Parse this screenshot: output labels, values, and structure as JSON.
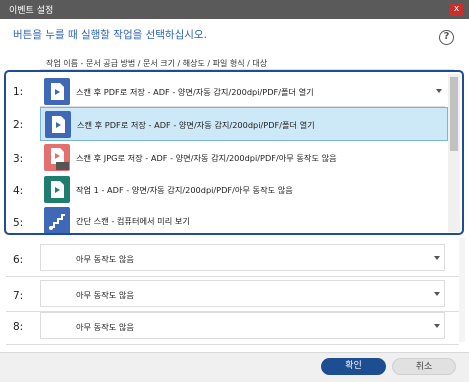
{
  "window": {
    "title": "이벤트 설정",
    "close_label": "x"
  },
  "instruction": "버튼을 누를 때 실행할 작업을 선택하십시오.",
  "help_label": "?",
  "column_header": "작업 이름 - 문서 공급 방법 / 문서 크기 / 해상도 / 파일 형식 / 대상",
  "rows": [
    {
      "num": "1:",
      "value": "스캔 후 PDF로 저장 - ADF - 양면/자동 감지/200dpi/PDF/폴더 열기"
    },
    {
      "num": "2:"
    },
    {
      "num": "3:"
    },
    {
      "num": "4:"
    },
    {
      "num": "5:"
    },
    {
      "num": "6:",
      "value": "아무 동작도 않음"
    },
    {
      "num": "7:",
      "value": "아무 동작도 않음"
    },
    {
      "num": "8:",
      "value": "아무 동작도 않음"
    }
  ],
  "dropdown_options": [
    {
      "label": "스캔 후 PDF로 저장 - ADF - 양면/자동 감지/200dpi/PDF/폴더 열기",
      "icon": "pdf-scan-icon",
      "color": "#3f69b6"
    },
    {
      "label": "스캔 후 JPG로 저장 - ADF - 양면/자동 감지/200dpi/PDF/아무 동작도 않음",
      "icon": "jpg-scan-icon",
      "color": "#e46f6f"
    },
    {
      "label": "작업 1 - ADF - 양면/자동 감지/200dpi/PDF/아무 동작도 않음",
      "icon": "job-icon",
      "color": "#1f7f6e"
    },
    {
      "label": "간단 스캔 - 컴퓨터에서 미리 보기",
      "icon": "simple-scan-icon",
      "color": "#3f69b6"
    }
  ],
  "buttons": {
    "ok": "확인",
    "cancel": "취소"
  },
  "colors": {
    "accent": "#1d4e91",
    "selection": "#cde8f6",
    "title_bar": "#5a5a5a",
    "close": "#c9302c"
  }
}
